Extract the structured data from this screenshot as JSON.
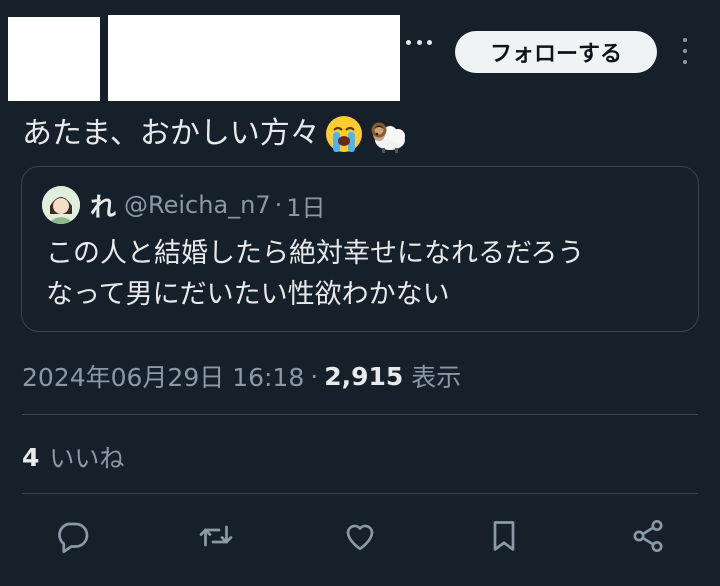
{
  "header": {
    "follow_label": "フォローする",
    "more_icon": "more-horizontal-icon",
    "menu_icon": "more-vertical-icon"
  },
  "tweet": {
    "text": "あたま、おかしい方々",
    "emojis": [
      "loudly-crying-face-emoji",
      "ram-emoji"
    ]
  },
  "quote": {
    "name": "れ",
    "handle": "@Reicha_n7",
    "separator": "·",
    "time": "1日",
    "lines": [
      "この人と結婚したら絶対幸せになれるだろう",
      "なって男にだいたい性欲わかない"
    ]
  },
  "meta": {
    "date": "2024年06月29日 16:18",
    "separator": "·",
    "views": "2,915",
    "views_label": "表示"
  },
  "likes": {
    "count": "4",
    "label": "いいね"
  },
  "actions": [
    "reply-icon",
    "retweet-icon",
    "like-icon",
    "bookmark-icon",
    "share-icon"
  ],
  "colors": {
    "background": "#15202b",
    "text": "#e7e9ea",
    "secondary_text": "#8b98a5",
    "border": "#38444d",
    "follow_button_bg": "#eff3f4"
  }
}
